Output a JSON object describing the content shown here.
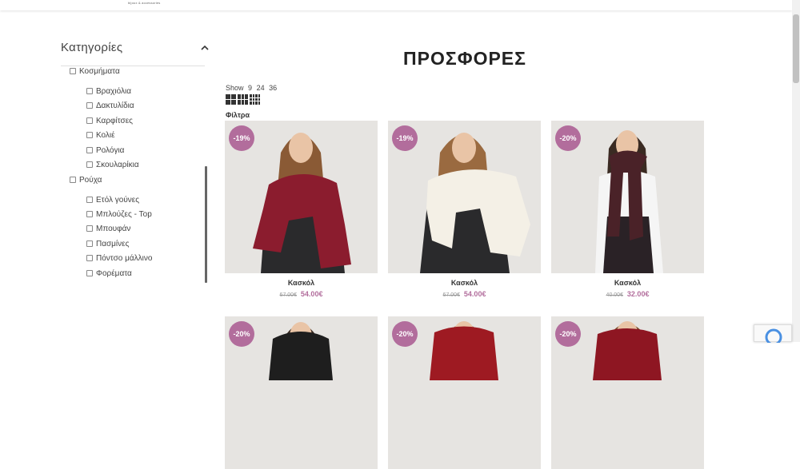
{
  "header": {
    "logo_tagline": "bijoux & accessories"
  },
  "sidebar": {
    "title": "Κατηγορίες",
    "categories": [
      {
        "label": "Κοσμήματα"
      },
      {
        "label": "Βραχιόλια"
      },
      {
        "label": "Δακτυλίδια"
      },
      {
        "label": "Καρφίτσες"
      },
      {
        "label": "Κολιέ"
      },
      {
        "label": "Ρολόγια"
      },
      {
        "label": "Σκουλαρίκια"
      },
      {
        "label": "Ρούχα"
      },
      {
        "label": "Ετόλ γούνες"
      },
      {
        "label": "Μπλούζες - Top"
      },
      {
        "label": "Μπουφάν"
      },
      {
        "label": "Πασμίνες"
      },
      {
        "label": "Πόντσο μάλλινο"
      },
      {
        "label": "Φορέματα"
      }
    ]
  },
  "main": {
    "title": "ΠΡΟΣΦΟΡΕΣ",
    "show_label": "Show",
    "show_options": [
      "9",
      "24",
      "36"
    ],
    "filters_label": "Φίλτρα",
    "products": [
      {
        "name": "Κασκόλ",
        "discount": "-19%",
        "old_price": "67.00€",
        "new_price": "54.00€",
        "scarf_color": "#8b1c2e"
      },
      {
        "name": "Κασκόλ",
        "discount": "-19%",
        "old_price": "67.00€",
        "new_price": "54.00€",
        "scarf_color": "#f4f0e6"
      },
      {
        "name": "Κασκόλ",
        "discount": "-20%",
        "old_price": "40.00€",
        "new_price": "32.00€",
        "scarf_color": "#4a2228"
      },
      {
        "discount": "-20%",
        "scarf_color": "#1e1e1e"
      },
      {
        "discount": "-20%",
        "scarf_color": "#9e1a22"
      },
      {
        "discount": "-20%",
        "scarf_color": "#8e1622"
      }
    ]
  }
}
